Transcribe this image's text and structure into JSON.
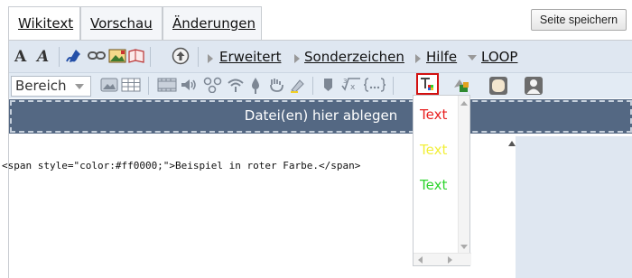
{
  "tabs": [
    {
      "label": "Wikitext",
      "active": true
    },
    {
      "label": "Vorschau",
      "active": false
    },
    {
      "label": "Änderungen",
      "active": false
    }
  ],
  "save_button": "Seite speichern",
  "toolbar": {
    "bold_glyph": "A",
    "italic_glyph": "A",
    "menus": [
      "Erweitert",
      "Sonderzeichen",
      "Hilfe",
      "LOOP"
    ],
    "heading_select": "Bereich"
  },
  "drop_zone": "Datei(en) hier ablegen",
  "editor_text": "<span style=\"color:#ff0000;\">Beispiel in roter Farbe.</span>",
  "color_options": [
    {
      "label": "Text",
      "color": "#e82020"
    },
    {
      "label": "Text",
      "color": "#f2ef3a"
    },
    {
      "label": "Text",
      "color": "#2ed42e"
    }
  ],
  "colors": {
    "toolbar_bg": "#dfe7f1",
    "drop_zone_bg": "#546883",
    "accent_red": "#d21010"
  },
  "icons": [
    "signature-icon",
    "link-icon",
    "image-icon",
    "gallery-icon",
    "upload-icon",
    "picture-icon",
    "table-icon",
    "video-icon",
    "audio-icon",
    "graph-icon",
    "wifi-icon",
    "dropper-icon",
    "hand-icon",
    "highlighter-icon",
    "reference-icon",
    "formula-icon",
    "ellipsis-brace-icon",
    "text-color-icon",
    "media-icon",
    "dialog-icon",
    "avatar-icon"
  ]
}
